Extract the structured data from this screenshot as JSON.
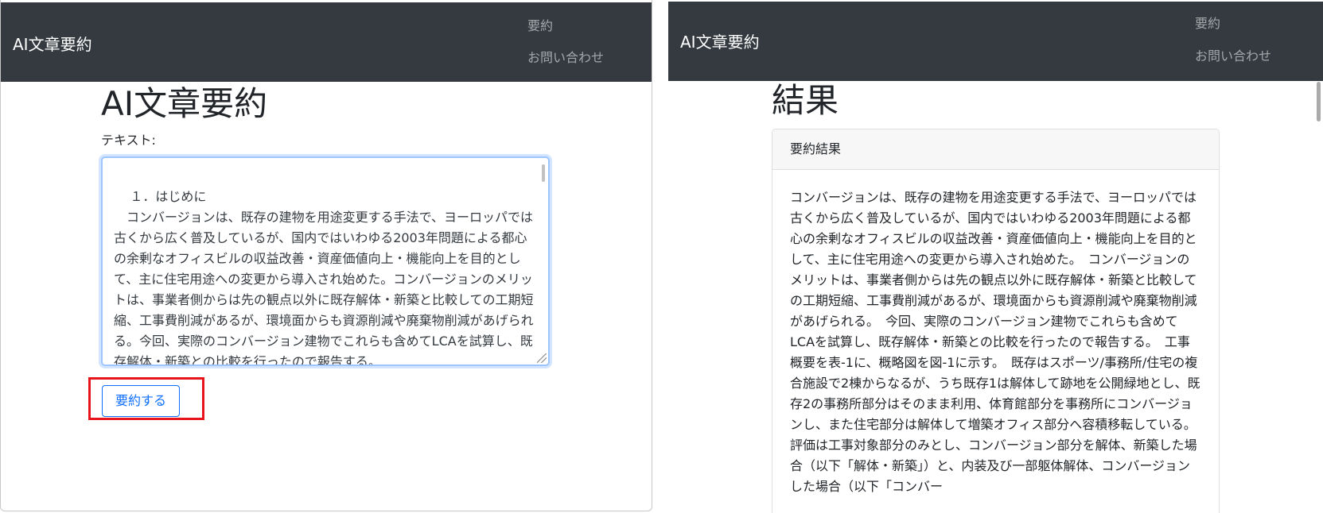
{
  "left": {
    "navbar": {
      "brand": "AI文章要約",
      "links": [
        "要約",
        "お問い合わせ"
      ]
    },
    "page_title": "AI文章要約",
    "form": {
      "label": "テキスト:",
      "textarea_value": "１．はじめに\n　コンバージョンは、既存の建物を用途変更する手法で、ヨーロッパでは古くから広く普及しているが、国内ではいわゆる2003年問題による都心の余剰なオフィスビルの収益改善・資産価値向上・機能向上を目的として、主に住宅用途への変更から導入され始めた。コンバージョンのメリットは、事業者側からは先の観点以外に既存解体・新築と比較しての工期短縮、工事費削減があるが、環境面からも資源削減や廃棄物削減があげられる。今回、実際のコンバージョン建物でこれらも含めてLCAを試算し、既存解体・新築との比較を行ったので報告する。",
      "submit_label": "要約する"
    },
    "highlight_color": "#e8141c"
  },
  "right": {
    "navbar": {
      "brand": "AI文章要約",
      "links": [
        "要約",
        "お問い合わせ"
      ]
    },
    "page_title": "結果",
    "card": {
      "header": "要約結果",
      "body": "コンバージョンは、既存の建物を用途変更する手法で、ヨーロッパでは古くから広く普及しているが、国内ではいわゆる2003年問題による都心の余剰なオフィスビルの収益改善・資産価値向上・機能向上を目的として、主に住宅用途への変更から導入され始めた。　コンバージョンのメリットは、事業者側からは先の観点以外に既存解体・新築と比較しての工期短縮、工事費削減があるが、環境面からも資源削減や廃棄物削減があげられる。　今回、実際のコンバージョン建物でこれらも含めてLCAを試算し、既存解体・新築との比較を行ったので報告する。　工事概要を表-1に、概略図を図-1に示す。　既存はスポーツ/事務所/住宅の複合施設で2棟からなるが、うち既存1は解体して跡地を公開緑地とし、既存2の事務所部分はそのまま利用、体育館部分を事務所にコンバージョンし、また住宅部分は解体して増築オフィス部分へ容積移転している。　評価は工事対象部分のみとし、コンバージョン部分を解体、新築した場合（以下「解体・新築」）と、内装及び一部躯体解体、コンバージョンした場合（以下「コンバー"
    }
  },
  "colors": {
    "navbar_bg": "#343a40",
    "primary": "#0d6efd",
    "nav_link": "rgba(255,255,255,0.55)"
  }
}
